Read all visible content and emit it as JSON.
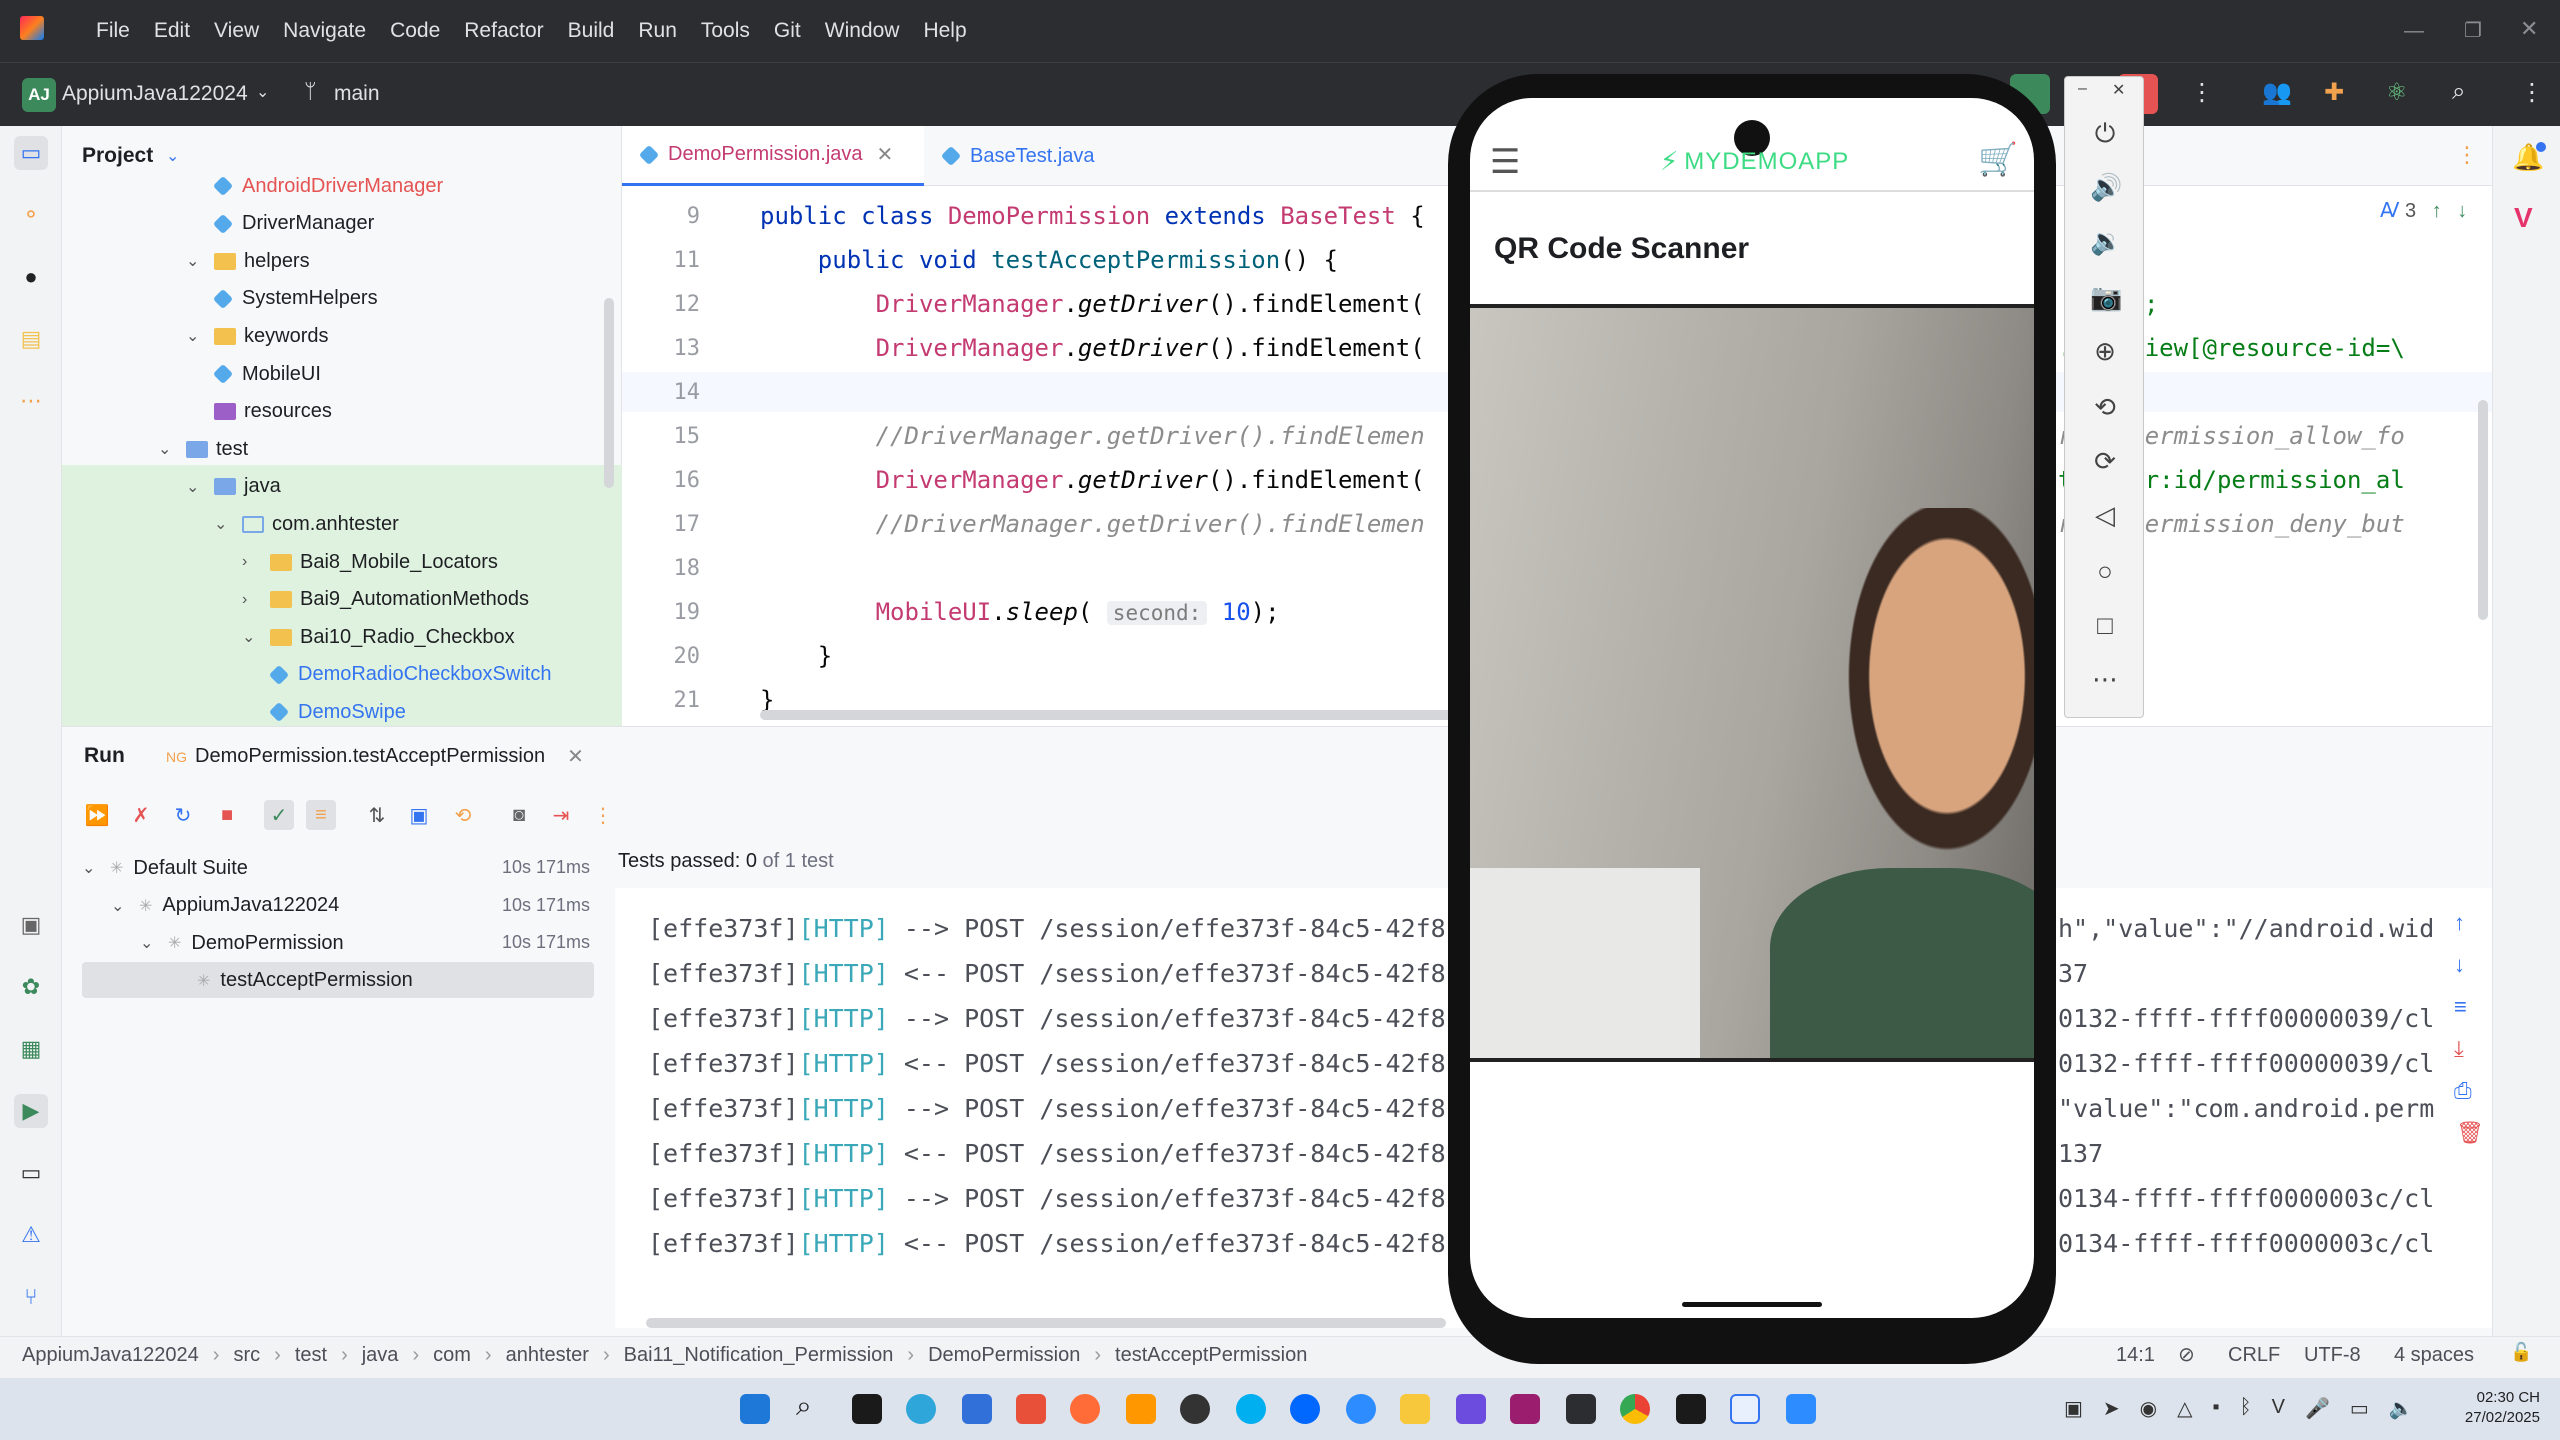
{
  "menu": [
    "File",
    "Edit",
    "View",
    "Navigate",
    "Code",
    "Refactor",
    "Build",
    "Run",
    "Tools",
    "Git",
    "Window",
    "Help"
  ],
  "toolbar": {
    "project_badge": "AJ",
    "project_name": "AppiumJava122024",
    "branch": "main"
  },
  "project_panel": {
    "title": "Project",
    "rows": [
      {
        "label": "AndroidDriverManager",
        "type": "class",
        "level": 3,
        "red": true
      },
      {
        "label": "DriverManager",
        "type": "class",
        "level": 3
      },
      {
        "label": "helpers",
        "type": "folder",
        "level": 2,
        "expanded": true
      },
      {
        "label": "SystemHelpers",
        "type": "class",
        "level": 3
      },
      {
        "label": "keywords",
        "type": "folder",
        "level": 2,
        "expanded": true
      },
      {
        "label": "MobileUI",
        "type": "class",
        "level": 3
      },
      {
        "label": "resources",
        "type": "folder-purple",
        "level": 2
      },
      {
        "label": "test",
        "type": "folder-test",
        "level": 1,
        "expanded": true
      },
      {
        "label": "java",
        "type": "folder-blue",
        "level": 2,
        "expanded": true
      },
      {
        "label": "com.anhtester",
        "type": "package",
        "level": 3,
        "expanded": true
      },
      {
        "label": "Bai8_Mobile_Locators",
        "type": "folder",
        "level": 4,
        "expanded": false
      },
      {
        "label": "Bai9_AutomationMethods",
        "type": "folder",
        "level": 4,
        "expanded": false
      },
      {
        "label": "Bai10_Radio_Checkbox",
        "type": "folder",
        "level": 4,
        "expanded": true
      },
      {
        "label": "DemoRadioCheckboxSwitch",
        "type": "class",
        "level": 5,
        "blue": true
      },
      {
        "label": "DemoSwipe",
        "type": "class",
        "level": 5,
        "blue": true
      }
    ]
  },
  "editor": {
    "tabs": [
      {
        "label": "DemoPermission.java",
        "active": true
      },
      {
        "label": "BaseTest.java",
        "active": false
      }
    ],
    "inspections": "3",
    "lines": [
      {
        "n": "9",
        "text": "public class DemoPermission extends BaseTest {"
      },
      {
        "n": "11",
        "text": "    public void testAcceptPermission() {"
      },
      {
        "n": "12",
        "text": "        DriverManager.getDriver().findElement("
      },
      {
        "n": "13",
        "text": "        DriverManager.getDriver().findElement("
      },
      {
        "n": "14",
        "text": ""
      },
      {
        "n": "15",
        "text": "        //DriverManager.getDriver().findElemen"
      },
      {
        "n": "16",
        "text": "        DriverManager.getDriver().findElement("
      },
      {
        "n": "17",
        "text": "        //DriverManager.getDriver().findElemen"
      },
      {
        "n": "18",
        "text": ""
      },
      {
        "n": "19",
        "text": "        MobileUI.sleep( second: 10);"
      },
      {
        "n": "20",
        "text": "    }"
      },
      {
        "n": "21",
        "text": "}"
      }
    ],
    "right_fragments": [
      ";",
      ".TextView[@resource-id=\\",
      "r:id/permission_allow_fo",
      "troller:id/permission_al",
      "r:id/permission_deny_but"
    ],
    "hint_label": "second:",
    "hint_value": "10"
  },
  "run": {
    "label": "Run",
    "config": "DemoPermission.testAcceptPermission",
    "tests_passed_label": "Tests passed:",
    "tests_passed_count": "0",
    "tests_passed_total": "of 1 test",
    "tree": [
      {
        "label": "Default Suite",
        "time": "10s 171ms",
        "level": 0
      },
      {
        "label": "AppiumJava122024",
        "time": "10s 171ms",
        "level": 1
      },
      {
        "label": "DemoPermission",
        "time": "10s 171ms",
        "level": 2
      },
      {
        "label": "testAcceptPermission",
        "time": "",
        "level": 3,
        "selected": true
      }
    ],
    "log": [
      {
        "id": "[effe373f]",
        "tag": "[HTTP]",
        "text": " --> POST /session/effe373f-84c5-42f8-",
        "tail": "h\",\"value\":\"//android.wid"
      },
      {
        "id": "[effe373f]",
        "tag": "[HTTP]",
        "text": " <-- POST /session/effe373f-84c5-42f8-",
        "tail": "37"
      },
      {
        "id": "[effe373f]",
        "tag": "[HTTP]",
        "text": " --> POST /session/effe373f-84c5-42f8-",
        "tail": "0132-ffff-ffff00000039/cl"
      },
      {
        "id": "[effe373f]",
        "tag": "[HTTP]",
        "text": " <-- POST /session/effe373f-84c5-42f8-",
        "tail": "0132-ffff-ffff00000039/cl"
      },
      {
        "id": "[effe373f]",
        "tag": "[HTTP]",
        "text": " --> POST /session/effe373f-84c5-42f8-",
        "tail": "\"value\":\"com.android.perm"
      },
      {
        "id": "[effe373f]",
        "tag": "[HTTP]",
        "text": " <-- POST /session/effe373f-84c5-42f8-",
        "tail": "137"
      },
      {
        "id": "[effe373f]",
        "tag": "[HTTP]",
        "text": " --> POST /session/effe373f-84c5-42f8-",
        "tail": "0134-ffff-ffff0000003c/cl"
      },
      {
        "id": "[effe373f]",
        "tag": "[HTTP]",
        "text": " <-- POST /session/effe373f-84c5-42f8-",
        "tail": "0134-ffff-ffff0000003c/cl"
      }
    ]
  },
  "phone": {
    "app_logo_text": "MYDEMOAPP",
    "screen_title": "QR Code Scanner"
  },
  "statusbar": {
    "breadcrumbs": [
      "AppiumJava122024",
      "src",
      "test",
      "java",
      "com",
      "anhtester",
      "Bai11_Notification_Permission",
      "DemoPermission",
      "testAcceptPermission"
    ],
    "position": "14:1",
    "line_ending": "CRLF",
    "encoding": "UTF-8",
    "indent": "4 spaces"
  },
  "taskbar": {
    "time": "02:30 CH",
    "date": "27/02/2025"
  },
  "colors": {
    "accent_green": "#3c8a5c",
    "keyword": "#0033b3",
    "class": "#c43b72",
    "http": "#3aa8b8",
    "stop_red": "#e55353"
  }
}
